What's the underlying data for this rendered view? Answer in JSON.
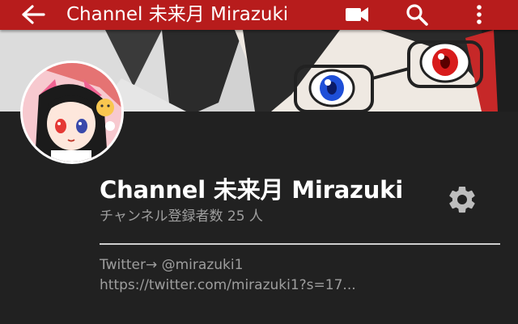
{
  "appbar": {
    "title": "Channel 未来月 Mirazuki",
    "back_icon": "arrow-back-icon",
    "icons": [
      "videocam-icon",
      "search-icon",
      "more-vert-icon"
    ],
    "color": "#b71c1c"
  },
  "channel": {
    "name": "Channel 未来月 Mirazuki",
    "subscribers": "チャンネル登録者数 25 人"
  },
  "description": {
    "line1": "Twitter→ @mirazuki1",
    "line2": "https://twitter.com/mirazuki1?s=17..."
  },
  "settings_icon": "gear-icon"
}
